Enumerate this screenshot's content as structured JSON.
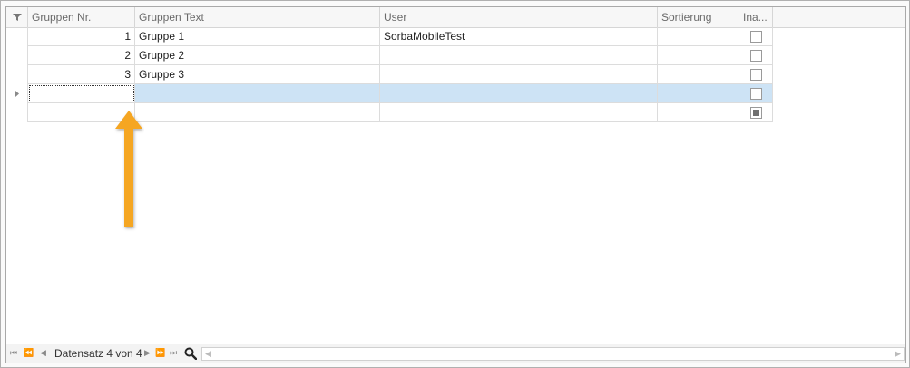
{
  "columns": [
    {
      "label": "Gruppen Nr."
    },
    {
      "label": "Gruppen Text"
    },
    {
      "label": "User"
    },
    {
      "label": "Sortierung"
    },
    {
      "label": "Ina..."
    }
  ],
  "rows": [
    {
      "nr": "1",
      "text": "Gruppe 1",
      "user": "SorbaMobileTest",
      "sort": "",
      "inactive": false
    },
    {
      "nr": "2",
      "text": "Gruppe 2",
      "user": "",
      "sort": "",
      "inactive": false
    },
    {
      "nr": "3",
      "text": "Gruppe 3",
      "user": "",
      "sort": "",
      "inactive": false
    },
    {
      "nr": "",
      "text": "",
      "user": "",
      "sort": "",
      "inactive": false
    },
    {
      "nr": "",
      "text": "",
      "user": "",
      "sort": "",
      "inactive": null
    }
  ],
  "navigator": {
    "record_text": "Datensatz 4 von 4"
  },
  "colors": {
    "selection": "#cde3f5",
    "arrow": "#f5a623"
  },
  "icons": [
    "filter-icon",
    "row-indicator-icon",
    "first-record-icon",
    "prev-page-icon",
    "prev-record-icon",
    "next-record-icon",
    "next-page-icon",
    "last-record-icon",
    "search-icon"
  ]
}
